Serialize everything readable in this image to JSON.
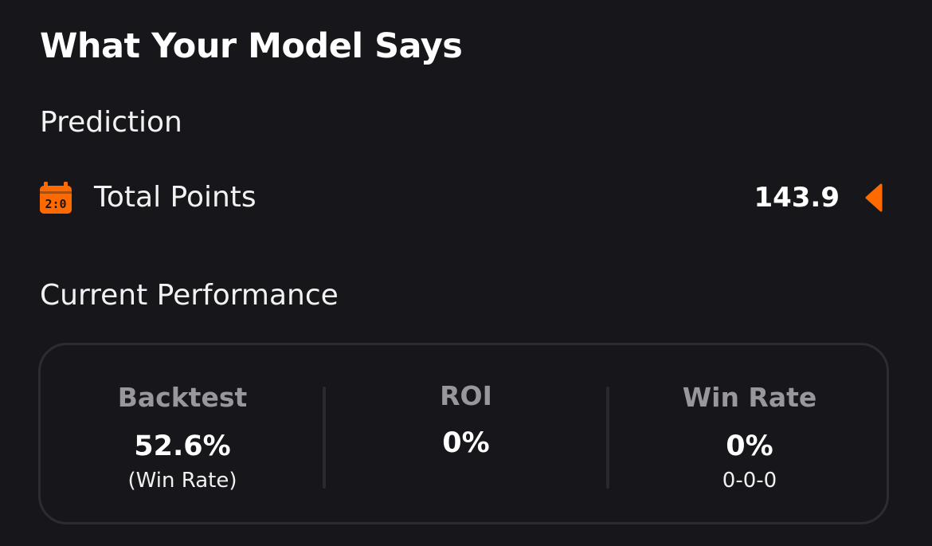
{
  "header": {
    "title": "What Your Model Says"
  },
  "prediction": {
    "section_label": "Prediction",
    "row": {
      "icon": "calendar-score-icon",
      "label": "Total Points",
      "value": "143.9",
      "indicator_icon": "caret-left-icon"
    }
  },
  "performance": {
    "section_label": "Current Performance",
    "stats": [
      {
        "label": "Backtest",
        "value": "52.6%",
        "sub": "(Win Rate)"
      },
      {
        "label": "ROI",
        "value": "0%",
        "sub": ""
      },
      {
        "label": "Win Rate",
        "value": "0%",
        "sub": "0-0-0"
      }
    ]
  },
  "colors": {
    "background": "#17171b",
    "accent": "#ff6a00",
    "muted_text": "#98989c",
    "card_border": "#2d2d31"
  }
}
